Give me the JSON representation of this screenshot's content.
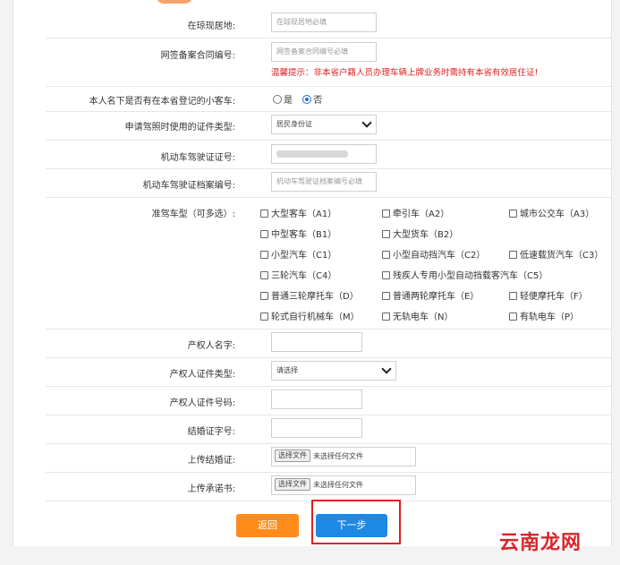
{
  "form": {
    "residence": {
      "label": "在琼现居地:",
      "placeholder": "在琼现居地必填"
    },
    "contract": {
      "label": "网签备案合同编号:",
      "placeholder": "网签备案合同编号必填"
    },
    "warning": "温馨提示：非本省户籍人员办理车辆上牌业务时需持有本省有效居住证!",
    "car_question": {
      "label": "本人名下是否有在本省登记的小客车:",
      "yes": "是",
      "no": "否"
    },
    "id_type": {
      "label": "申请驾照时使用的证件类型:",
      "value": "居民身份证"
    },
    "license_no": {
      "label": "机动车驾驶证证号:"
    },
    "archive_no": {
      "label": "机动车驾驶证档案编号:",
      "placeholder": "机动车驾驶证档案编号必填"
    },
    "vehicle_types": {
      "label": "准驾车型（可多选）:",
      "options": [
        "大型客车（A1）",
        "牵引车（A2）",
        "城市公交车（A3）",
        "中型客车（B1）",
        "大型货车（B2）",
        "小型汽车（C1）",
        "小型自动挡汽车（C2）",
        "低速载货汽车（C3）",
        "三轮汽车（C4）",
        "残疾人专用小型自动挡载客汽车（C5）",
        "普通三轮摩托车（D）",
        "普通两轮摩托车（E）",
        "轻便摩托车（F）",
        "轮式自行机械车（M）",
        "无轨电车（N）",
        "有轨电车（P）"
      ]
    },
    "owner_name": {
      "label": "产权人名字:"
    },
    "owner_id_type": {
      "label": "产权人证件类型:",
      "value": "请选择"
    },
    "owner_id_no": {
      "label": "产权人证件号码:"
    },
    "marriage_no": {
      "label": "结婚证字号:"
    },
    "upload_marriage": {
      "label": "上传结婚证:",
      "button": "选择文件",
      "status": "未选择任何文件"
    },
    "upload_promise": {
      "label": "上传承诺书:",
      "button": "选择文件",
      "status": "未选择任何文件"
    }
  },
  "buttons": {
    "back": "返回",
    "next": "下一步"
  },
  "watermark": "云南龙网",
  "colors": {
    "back": "#ff8c1a",
    "next": "#1e88e5",
    "highlight": "#e02020",
    "watermark": "#d8262c"
  }
}
